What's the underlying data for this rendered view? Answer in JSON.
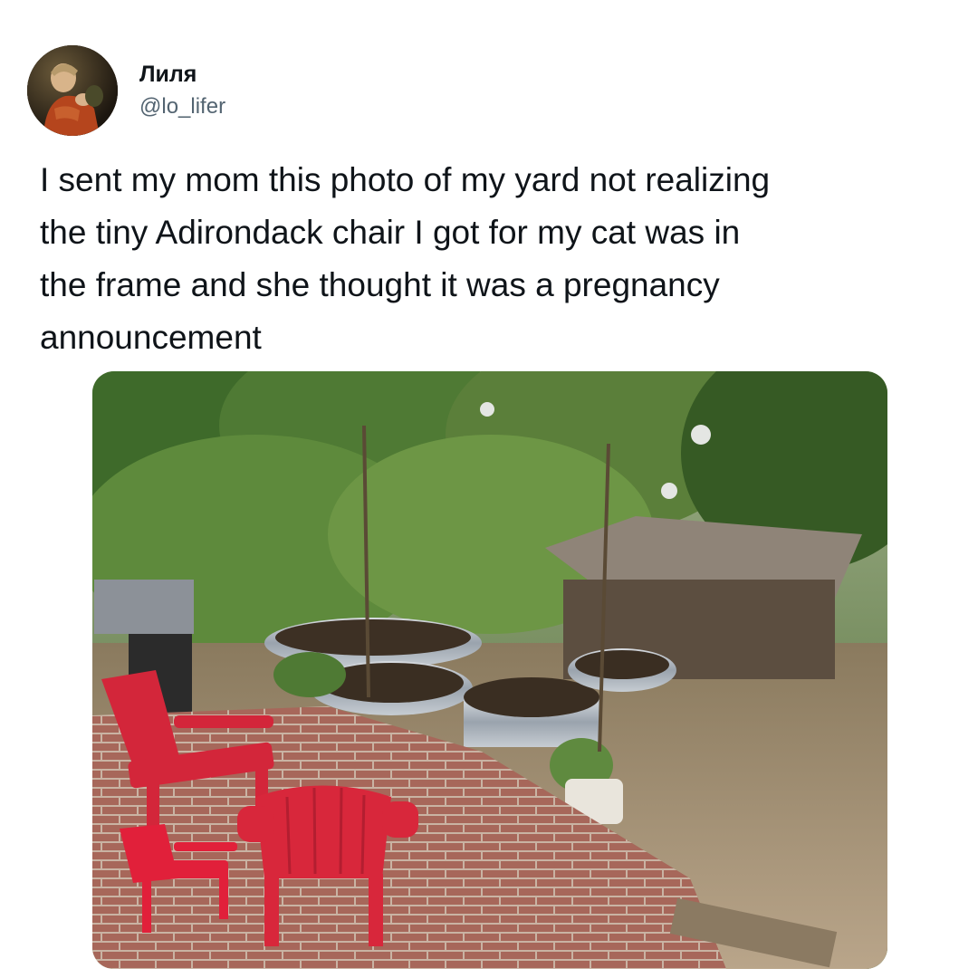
{
  "author": {
    "display_name": "Лиля",
    "handle": "@lo_lifer",
    "avatar_icon": "avatar-painting-portrait"
  },
  "tweet": {
    "text": "I sent my mom this photo of my yard not realizing\nthe tiny Adirondack chair I got for my cat was in\nthe frame and she thought it was a pregnancy\nannouncement"
  },
  "media": {
    "type": "photo",
    "subjects": [
      "red adirondack chairs",
      "tiny red adirondack chair",
      "raised garden beds",
      "brick patio",
      "shed",
      "grill"
    ]
  },
  "colors": {
    "text_primary": "#0f1419",
    "text_secondary": "#536471",
    "background": "#ffffff"
  }
}
